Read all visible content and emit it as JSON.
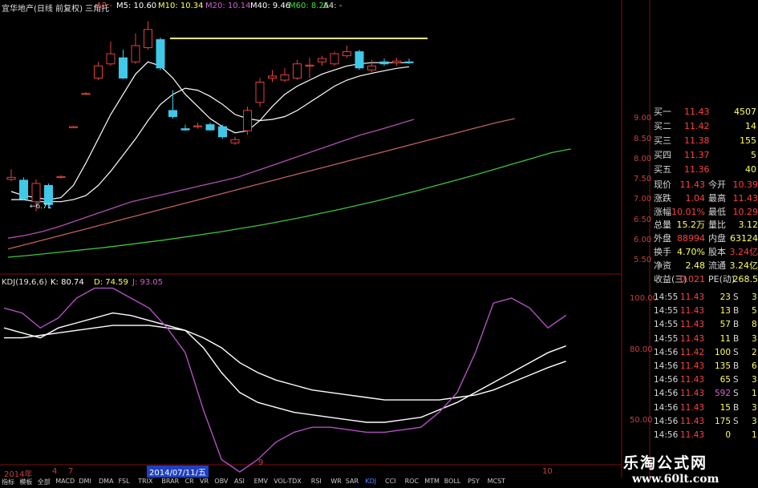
{
  "colors": {
    "up": "#e04040",
    "down": "#40c8e8",
    "ma5": "#ffffff",
    "ma10": "#ffffff",
    "ma20": "#b050b0",
    "ma40": "#c06060",
    "ma60": "#40c040",
    "k": "#ffffff",
    "d": "#ffffff",
    "j": "#b050c0",
    "grid": "#7a1010",
    "resistance": "#f0f090"
  },
  "header": {
    "title": "宜华地产(日线 前复权) 三角托",
    "a2": "A2:-",
    "ma5": "M5: 10.60",
    "ma10": "M10: 10.34",
    "ma20": "M20: 10.14",
    "ma40": "M40: 9.46",
    "ma60": "M60: 8.25",
    "a4": "A4: -"
  },
  "price_axis": [
    "9.00",
    "8.50",
    "8.00",
    "7.50",
    "7.00",
    "6.50",
    "6.00",
    "5.50"
  ],
  "low_label": "←6.71",
  "kdj": {
    "title": "KDJ(19,6,6)",
    "k": "K: 80.74",
    "d": "D: 74.59",
    "j": "J: 93.05",
    "axis": [
      "100.00",
      "80.00",
      "50.00"
    ]
  },
  "date_axis": {
    "year": "2014年",
    "m4": "4",
    "m7": "7",
    "cursor": "2014/07/11/五",
    "m9": "9",
    "m10": "10"
  },
  "toolbar": [
    "指标",
    "模板",
    "全部",
    "MACD",
    "DMI",
    "DMA",
    "FSL",
    "TRIX",
    "BRAR",
    "CR",
    "VR",
    "OBV",
    "ASI",
    "EMV",
    "VOL-TDX",
    "RSI",
    "WR",
    "SAR",
    "KDJ",
    "CCI",
    "ROC",
    "MTM",
    "BOLL",
    "PSY",
    "MCST"
  ],
  "quote": {
    "buy": [
      {
        "name": "买一",
        "price": "11.43",
        "vol": "4507"
      },
      {
        "name": "买二",
        "price": "11.42",
        "vol": "14"
      },
      {
        "name": "买三",
        "price": "11.38",
        "vol": "155"
      },
      {
        "name": "买四",
        "price": "11.37",
        "vol": "5"
      },
      {
        "name": "买五",
        "price": "11.36",
        "vol": "40"
      }
    ],
    "stats": [
      {
        "n1": "现价",
        "v1": "11.43",
        "n2": "今开",
        "v2": "10.39"
      },
      {
        "n1": "涨跌",
        "v1": "1.04",
        "n2": "最高",
        "v2": "11.43"
      },
      {
        "n1": "涨幅",
        "v1": "10.01%",
        "n2": "最低",
        "v2": "10.29"
      },
      {
        "n1": "总量",
        "v1": "15.2万",
        "n2": "量比",
        "v2": "3.12"
      },
      {
        "n1": "外盘",
        "v1": "88994",
        "n2": "内盘",
        "v2": "63124"
      },
      {
        "n1": "换手",
        "v1": "4.70%",
        "n2": "股本",
        "v2": "3.24亿"
      },
      {
        "n1": "净资",
        "v1": "2.48",
        "n2": "流通",
        "v2": "3.24亿"
      },
      {
        "n1": "收益(三)",
        "v1": "0.021",
        "n2": "PE(动)",
        "v2": "268.5"
      }
    ],
    "ticks": [
      {
        "time": "14:55",
        "price": "11.43",
        "vol": "23",
        "side": "S",
        "cnt": "3"
      },
      {
        "time": "14:55",
        "price": "11.43",
        "vol": "13",
        "side": "B",
        "cnt": "5"
      },
      {
        "time": "14:55",
        "price": "11.43",
        "vol": "57",
        "side": "B",
        "cnt": "8"
      },
      {
        "time": "14:55",
        "price": "11.43",
        "vol": "11",
        "side": "B",
        "cnt": "3"
      },
      {
        "time": "14:56",
        "price": "11.42",
        "vol": "100",
        "side": "S",
        "cnt": "2"
      },
      {
        "time": "14:56",
        "price": "11.43",
        "vol": "135",
        "side": "B",
        "cnt": "6"
      },
      {
        "time": "14:56",
        "price": "11.43",
        "vol": "65",
        "side": "S",
        "cnt": "3"
      },
      {
        "time": "14:56",
        "price": "11.43",
        "vol": "592",
        "side": "S",
        "cnt": "1"
      },
      {
        "time": "14:56",
        "price": "11.43",
        "vol": "15",
        "side": "B",
        "cnt": "3"
      },
      {
        "time": "14:56",
        "price": "11.43",
        "vol": "175",
        "side": "S",
        "cnt": "3"
      },
      {
        "time": "14:56",
        "price": "11.43",
        "vol": "0",
        "side": "",
        "cnt": "1"
      }
    ]
  },
  "watermark": {
    "cn": "乐淘公式网",
    "url": "www.60lt.com"
  },
  "chart_data": [
    {
      "type": "candlestick",
      "title": "宜华地产(日线 前复权)",
      "ylim": [
        5.3,
        10.9
      ],
      "candles": [
        {
          "o": 7.5,
          "c": 7.55,
          "h": 7.75,
          "l": 7.45
        },
        {
          "o": 7.48,
          "c": 7.02,
          "h": 7.55,
          "l": 6.98
        },
        {
          "o": 6.95,
          "c": 7.4,
          "h": 7.5,
          "l": 6.71
        },
        {
          "o": 7.35,
          "c": 6.88,
          "h": 7.4,
          "l": 6.8
        },
        {
          "o": 7.55,
          "c": 7.57,
          "h": 7.6,
          "l": 7.52
        },
        {
          "o": 8.8,
          "c": 8.8,
          "h": 8.82,
          "l": 8.78
        },
        {
          "o": 9.6,
          "c": 9.62,
          "h": 9.65,
          "l": 9.58
        },
        {
          "o": 10.0,
          "c": 10.3,
          "h": 10.4,
          "l": 9.95
        },
        {
          "o": 10.35,
          "c": 10.6,
          "h": 10.9,
          "l": 10.3
        },
        {
          "o": 10.5,
          "c": 10.0,
          "h": 10.7,
          "l": 9.98
        },
        {
          "o": 10.4,
          "c": 10.8,
          "h": 11.1,
          "l": 10.35
        },
        {
          "o": 10.75,
          "c": 11.2,
          "h": 11.4,
          "l": 10.7
        },
        {
          "o": 10.95,
          "c": 10.25,
          "h": 11.0,
          "l": 10.2
        },
        {
          "o": 9.2,
          "c": 9.05,
          "h": 9.7,
          "l": 9.0
        },
        {
          "o": 8.75,
          "c": 8.72,
          "h": 8.85,
          "l": 8.7
        },
        {
          "o": 8.8,
          "c": 8.82,
          "h": 8.9,
          "l": 8.75
        },
        {
          "o": 8.85,
          "c": 8.72,
          "h": 8.9,
          "l": 8.7
        },
        {
          "o": 8.8,
          "c": 8.55,
          "h": 8.85,
          "l": 8.5
        },
        {
          "o": 8.4,
          "c": 8.48,
          "h": 8.55,
          "l": 8.35
        },
        {
          "o": 8.7,
          "c": 9.2,
          "h": 9.3,
          "l": 8.6
        },
        {
          "o": 9.4,
          "c": 9.9,
          "h": 10.0,
          "l": 9.3
        },
        {
          "o": 10.0,
          "c": 10.05,
          "h": 10.2,
          "l": 9.9
        },
        {
          "o": 9.95,
          "c": 10.08,
          "h": 10.25,
          "l": 9.9
        },
        {
          "o": 10.0,
          "c": 10.35,
          "h": 10.45,
          "l": 9.95
        },
        {
          "o": 10.3,
          "c": 10.32,
          "h": 10.5,
          "l": 10.0
        },
        {
          "o": 10.4,
          "c": 10.48,
          "h": 10.55,
          "l": 10.3
        },
        {
          "o": 10.35,
          "c": 10.6,
          "h": 10.65,
          "l": 10.3
        },
        {
          "o": 10.55,
          "c": 10.65,
          "h": 10.8,
          "l": 10.5
        },
        {
          "o": 10.65,
          "c": 10.25,
          "h": 10.7,
          "l": 10.2
        },
        {
          "o": 10.2,
          "c": 10.3,
          "h": 10.45,
          "l": 10.15
        },
        {
          "o": 10.4,
          "c": 10.35,
          "h": 10.48,
          "l": 10.3
        },
        {
          "o": 10.38,
          "c": 10.42,
          "h": 10.5,
          "l": 10.3
        },
        {
          "o": 10.4,
          "c": 10.38,
          "h": 10.48,
          "l": 10.35
        }
      ],
      "resistance": 10.98,
      "ma": {
        "ma5": [
          7.2,
          7.1,
          7.05,
          7.0,
          7.05,
          7.35,
          7.9,
          8.5,
          9.1,
          9.6,
          10.1,
          10.4,
          10.3,
          10.0,
          9.6,
          9.3,
          9.0,
          8.8,
          8.65,
          8.7,
          8.95,
          9.3,
          9.6,
          9.8,
          9.95,
          10.1,
          10.2,
          10.3,
          10.35,
          10.38,
          10.38,
          10.38,
          10.38
        ],
        "ma10": [
          7.0,
          7.0,
          6.95,
          6.95,
          6.95,
          7.0,
          7.1,
          7.35,
          7.7,
          8.1,
          8.5,
          8.95,
          9.35,
          9.6,
          9.75,
          9.7,
          9.55,
          9.35,
          9.1,
          9.0,
          8.95,
          8.98,
          9.05,
          9.2,
          9.4,
          9.6,
          9.8,
          9.95,
          10.05,
          10.12,
          10.18,
          10.24,
          10.28
        ]
      },
      "mid_lines": {
        "ma20": [
          6.05,
          6.12,
          6.22,
          6.35,
          6.5,
          6.65,
          6.8,
          6.95,
          7.05,
          7.15,
          7.25,
          7.35,
          7.45,
          7.55,
          7.7,
          7.85,
          8.0,
          8.15,
          8.3,
          8.45,
          8.6,
          8.72,
          8.85,
          8.98
        ],
        "ma40": [
          5.78,
          5.9,
          6.02,
          6.14,
          6.26,
          6.38,
          6.5,
          6.62,
          6.74,
          6.86,
          6.98,
          7.1,
          7.22,
          7.34,
          7.46,
          7.58,
          7.7,
          7.82,
          7.94,
          8.06,
          8.18,
          8.3,
          8.42,
          8.54,
          8.66,
          8.78,
          8.9,
          9.0
        ],
        "ma60": [
          5.58,
          5.62,
          5.67,
          5.72,
          5.77,
          5.82,
          5.88,
          5.94,
          6.0,
          6.07,
          6.14,
          6.21,
          6.29,
          6.37,
          6.46,
          6.55,
          6.65,
          6.75,
          6.86,
          6.97,
          7.09,
          7.21,
          7.34,
          7.47,
          7.6,
          7.74,
          7.88,
          8.02,
          8.16,
          8.25
        ]
      }
    },
    {
      "type": "line",
      "title": "KDJ(19,6,6)",
      "ylim": [
        40,
        110
      ],
      "series": [
        {
          "name": "K",
          "values": [
            88,
            86,
            84,
            88,
            90,
            92,
            94,
            93,
            91,
            89,
            87,
            80,
            70,
            62,
            58,
            56,
            54,
            53,
            52,
            51,
            50,
            50,
            51,
            52,
            55,
            58,
            62,
            66,
            70,
            74,
            78,
            80.74
          ]
        },
        {
          "name": "D",
          "values": [
            84,
            84,
            85,
            86,
            87,
            88,
            89,
            89,
            89,
            88,
            87,
            84,
            80,
            74,
            70,
            67,
            65,
            63,
            62,
            61,
            60,
            59,
            59,
            59,
            59,
            60,
            61,
            63,
            66,
            69,
            72,
            74.59
          ]
        },
        {
          "name": "J",
          "values": [
            96,
            94,
            88,
            92,
            100,
            104,
            104,
            100,
            96,
            88,
            78,
            55,
            35,
            30,
            35,
            42,
            46,
            48,
            48,
            47,
            46,
            46,
            47,
            48,
            54,
            62,
            78,
            98,
            100,
            96,
            88,
            93.05
          ]
        }
      ]
    }
  ]
}
